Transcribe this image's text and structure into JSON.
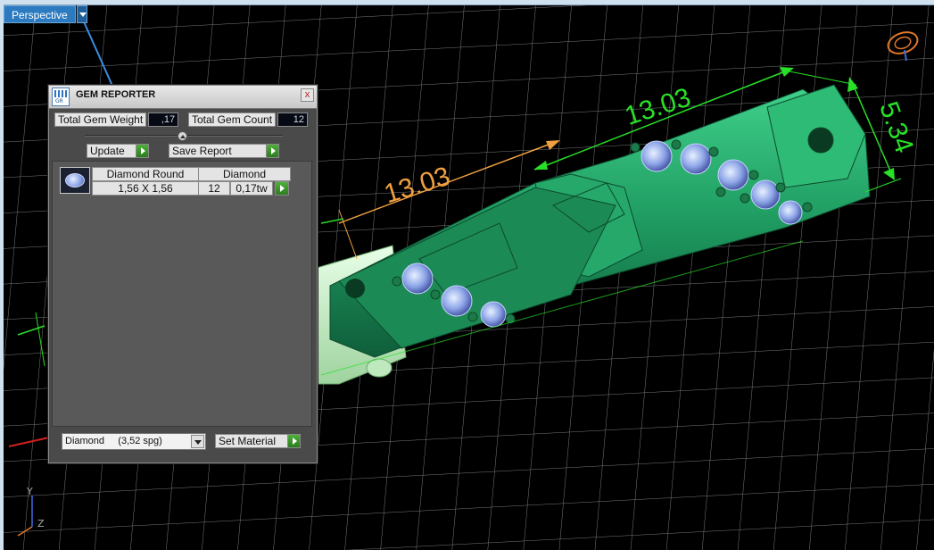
{
  "viewport": {
    "view_mode": "Perspective",
    "dimensions": [
      "13.03",
      "13.03",
      "5.34"
    ],
    "axis_labels": {
      "y": "Y",
      "z": "Z"
    },
    "colors": {
      "model": "#1f9a62",
      "dimension_green": "#28e028",
      "dimension_orange": "#f0a040",
      "gem": "#8fa4f0",
      "grid": "#6b6b6b"
    }
  },
  "gem_reporter": {
    "title": "GEM REPORTER",
    "close_label": "x",
    "total_weight_label": "Total Gem Weight",
    "total_weight_value": ",17",
    "total_count_label": "Total Gem Count",
    "total_count_value": "12",
    "update_label": "Update",
    "save_report_label": "Save Report",
    "gems": [
      {
        "shape": "Diamond Round",
        "material": "Diamond",
        "size": "1,56 X 1,56",
        "count": "12",
        "weight": "0,17tw"
      }
    ],
    "material_select_value": "Diamond     (3,52 spg)",
    "set_material_label": "Set Material"
  }
}
